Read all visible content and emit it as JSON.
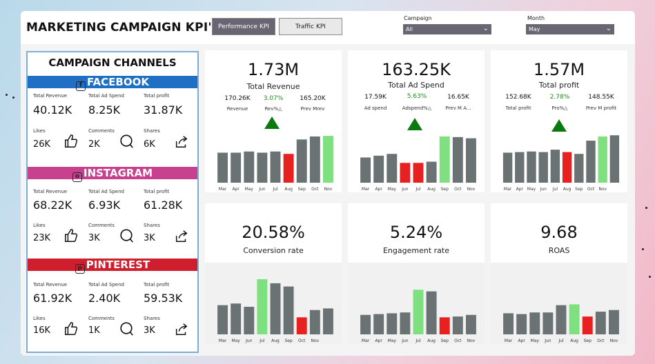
{
  "header": {
    "title": "MARKETING CAMPAIGN KPI'S",
    "tabs": [
      "Performance KPI",
      "Traffic KPI"
    ],
    "campaign_label": "Campaign",
    "campaign_value": "All",
    "month_label": "Month",
    "month_value": "May"
  },
  "channels": {
    "title": "CAMPAIGN  CHANNELS",
    "labels": {
      "revenue": "Total Revenue",
      "ad_spend": "Total Ad Spend",
      "profit": "Total profit",
      "likes": "Likes",
      "comments": "Comments",
      "shares": "Shares"
    },
    "facebook": {
      "name": "FACEBOOK",
      "revenue": "40.12K",
      "ad_spend": "8.25K",
      "profit": "31.87K",
      "likes": "26K",
      "comments": "2K",
      "shares": "6K"
    },
    "instagram": {
      "name": "INSTAGRAM",
      "revenue": "68.22K",
      "ad_spend": "6.93K",
      "profit": "61.28K",
      "likes": "23K",
      "comments": "3K",
      "shares": "3K"
    },
    "pinterest": {
      "name": "PINTEREST",
      "revenue": "61.92K",
      "ad_spend": "2.40K",
      "profit": "59.53K",
      "likes": "16K",
      "comments": "1K",
      "shares": "3K"
    }
  },
  "colors": {
    "facebook": "#1f6fc5",
    "instagram": "#c8418f",
    "pinterest": "#cf1f2e",
    "bar_default": "#6b7273",
    "bar_high": "#7ee07e",
    "bar_low": "#e82020",
    "up_arrow": "#0a7a10",
    "tab_active": "#6a6573"
  },
  "cards": [
    {
      "big": "1.73M",
      "sub": "Total Revenue",
      "k1v": "170.26K",
      "k1l": "Revenue",
      "k2v": "3.07%",
      "k2l": "Rev%△",
      "k3v": "165.20K",
      "k3l": "Prev Mrev",
      "arrow": true
    },
    {
      "big": "163.25K",
      "sub": "Total Ad Spend",
      "k1v": "17.59K",
      "k1l": "Ad spend",
      "k2v": "5.63%",
      "k2l": "Adspend%△",
      "k3v": "16.65K",
      "k3l": "Prev M A...",
      "arrow": true
    },
    {
      "big": "1.57M",
      "sub": "Total profit",
      "k1v": "152.68K",
      "k1l": "Total profit",
      "k2v": "2.78%",
      "k2l": "Pro%△",
      "k3v": "148.55K",
      "k3l": "Prev M profit",
      "arrow": true
    },
    {
      "big": "20.58%",
      "sub": "Conversion rate",
      "arrow": false
    },
    {
      "big": "5.24%",
      "sub": "Engagement rate",
      "arrow": false
    },
    {
      "big": "9.68",
      "sub": "ROAS",
      "arrow": false
    }
  ],
  "chart_data": [
    {
      "type": "bar",
      "categories": [
        "Mar",
        "Apr",
        "May",
        "Jun",
        "Jul",
        "Aug",
        "Sep",
        "Oct",
        "Nov"
      ],
      "values": [
        50,
        50,
        52,
        50,
        52,
        48,
        72,
        77,
        78
      ],
      "highlight": [
        null,
        null,
        null,
        null,
        null,
        "low",
        null,
        null,
        "high"
      ]
    },
    {
      "type": "bar",
      "categories": [
        "Mar",
        "Apr",
        "May",
        "Jun",
        "Jul",
        "Aug",
        "Sep",
        "Oct",
        "Nov"
      ],
      "values": [
        42,
        45,
        48,
        33,
        33,
        35,
        77,
        76,
        74
      ],
      "highlight": [
        null,
        null,
        null,
        "low",
        "low",
        null,
        "high",
        null,
        null
      ]
    },
    {
      "type": "bar",
      "categories": [
        "Mar",
        "Apr",
        "May",
        "Jun",
        "Jul",
        "Aug",
        "Sep",
        "Oct",
        "Nov"
      ],
      "values": [
        50,
        51,
        52,
        51,
        55,
        51,
        48,
        70,
        77,
        79
      ],
      "categories_full": true,
      "highlight": [
        null,
        null,
        null,
        null,
        null,
        "low",
        null,
        null,
        "high"
      ]
    },
    {
      "type": "bar",
      "categories": [
        "Mar",
        "May",
        "Jun",
        "Jul",
        "Aug",
        "Sep",
        "Oct",
        "Nov"
      ],
      "values": [
        36,
        38,
        34,
        68,
        63,
        59,
        21,
        30,
        32
      ],
      "highlight": [
        null,
        null,
        null,
        "high",
        null,
        null,
        "low",
        null,
        null
      ]
    },
    {
      "type": "bar",
      "categories": [
        "Mar",
        "Apr",
        "May",
        "Jun",
        "Jul",
        "Aug",
        "Sep",
        "Oct",
        "Nov"
      ],
      "values": [
        24,
        25,
        26,
        27,
        55,
        53,
        21,
        22,
        24
      ],
      "highlight": [
        null,
        null,
        null,
        null,
        "high",
        null,
        "low",
        null,
        null
      ]
    },
    {
      "type": "bar",
      "categories": [
        "Mar",
        "Apr",
        "May",
        "Jun",
        "Jul",
        "Aug",
        "Sep",
        "Oct",
        "Nov"
      ],
      "values": [
        26,
        25,
        27,
        27,
        36,
        37,
        22,
        28,
        30
      ],
      "highlight": [
        null,
        null,
        null,
        null,
        null,
        "high",
        "low",
        null,
        null
      ]
    }
  ]
}
